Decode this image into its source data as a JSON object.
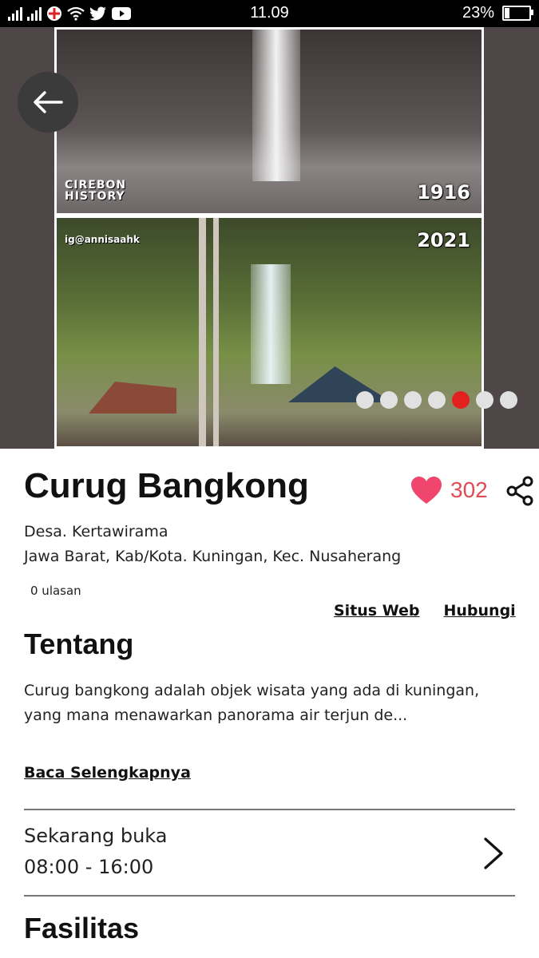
{
  "status_bar": {
    "time": "11.09",
    "battery": "23%"
  },
  "hero": {
    "year_top": "1916",
    "year_bottom": "2021",
    "watermark_top": "CIREBON HISTORY",
    "watermark_bottom": "ig@annisaahk",
    "slide_count": 7,
    "active_slide": 5
  },
  "place": {
    "name": "Curug Bangkong",
    "likes": "302",
    "address_line1": "Desa. Kertawirama",
    "address_line2": "Jawa Barat, Kab/Kota. Kuningan, Kec. Nusaherang",
    "reviews": "0 ulasan"
  },
  "links": {
    "website": "Situs Web",
    "contact": "Hubungi"
  },
  "about": {
    "heading": "Tentang",
    "text": "Curug bangkong adalah objek wisata yang ada di kuningan, yang mana menawarkan panorama air terjun de...",
    "read_more": "Baca Selengkapnya"
  },
  "hours": {
    "status": "Sekarang buka",
    "time": "08:00 - 16:00"
  },
  "facilities": {
    "heading": "Fasilitas"
  },
  "colors": {
    "accent_red": "#e32020",
    "like_pink": "#f0466e",
    "like_count": "#e14b54"
  }
}
